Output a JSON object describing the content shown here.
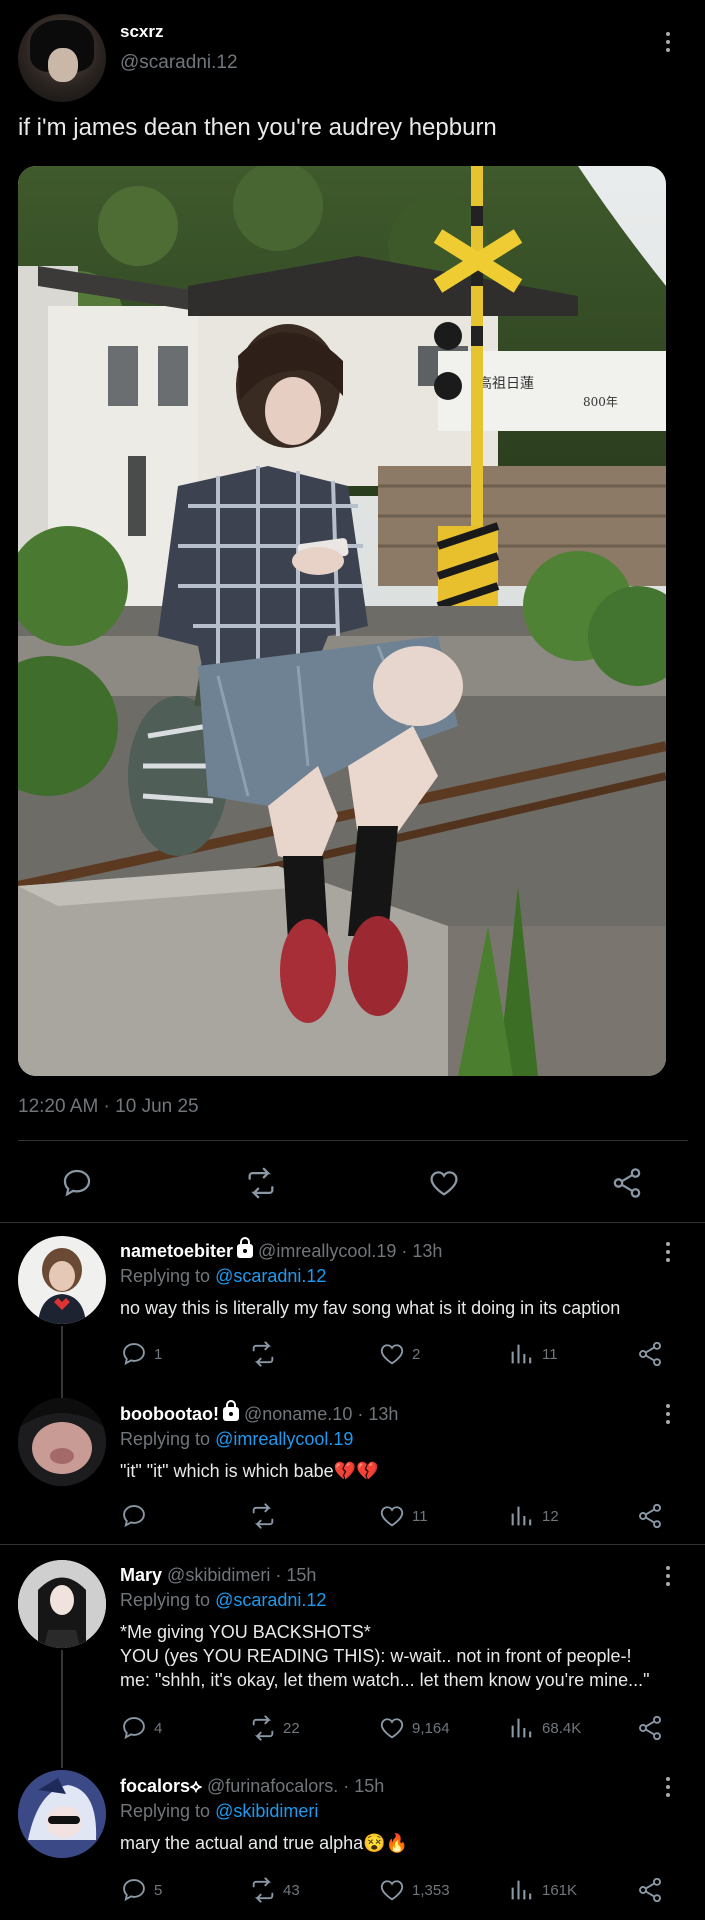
{
  "post": {
    "name": "scxrz",
    "handle": "@scaradni.12",
    "text": "if i'm james dean then you're audrey hepburn",
    "timestamp": "12:20 AM · 10 Jun 25",
    "image_alt": "photo of person in plaid shirt sitting on concrete ledge by railway crossing, looking at phone",
    "image_sign_text": "高祖日蓮 ... 800年"
  },
  "replies": [
    {
      "name": "nametoebiter",
      "locked": true,
      "handle": "@imreallycool.19",
      "time": "13h",
      "replying_prefix": "Replying to",
      "replying_to": "@scaradni.12",
      "lines": [
        "no way this is literally my fav song what is it doing in its caption"
      ],
      "stats": {
        "replies": "1",
        "reposts": "",
        "likes": "2",
        "views": "11"
      }
    },
    {
      "name": "boobootao!",
      "locked": true,
      "handle": "@noname.10",
      "time": "13h",
      "replying_prefix": "Replying to",
      "replying_to": "@imreallycool.19",
      "lines": [
        "\"it\" \"it\" which is which babe💔💔"
      ],
      "stats": {
        "replies": "",
        "reposts": "",
        "likes": "11",
        "views": "12"
      }
    },
    {
      "name": "Mary",
      "locked": false,
      "handle": "@skibidimeri",
      "time": "15h",
      "replying_prefix": "Replying to",
      "replying_to": "@scaradni.12",
      "lines": [
        "*Me giving YOU BACKSHOTS*",
        "YOU (yes YOU READING THIS): w-wait.. not in front of people-!",
        "me: \"shhh, it's okay, let them watch... let them know you're mine...\""
      ],
      "stats": {
        "replies": "4",
        "reposts": "22",
        "likes": "9,164",
        "views": "68.4K"
      }
    },
    {
      "name": "focalors⟡",
      "locked": false,
      "handle": "@furinafocalors.",
      "time": "15h",
      "replying_prefix": "Replying to",
      "replying_to": "@skibidimeri",
      "lines": [
        "mary the actual and true alpha😵🔥"
      ],
      "stats": {
        "replies": "5",
        "reposts": "43",
        "likes": "1,353",
        "views": "161K"
      }
    }
  ],
  "colors": {
    "bg": "#000000",
    "text": "#e7e9ea",
    "muted": "#71767b",
    "link": "#1d9bf0",
    "separator": "#2f3336"
  },
  "icons": [
    "reply-icon",
    "repost-icon",
    "like-icon",
    "views-icon",
    "share-icon",
    "more-icon",
    "lock-icon"
  ]
}
